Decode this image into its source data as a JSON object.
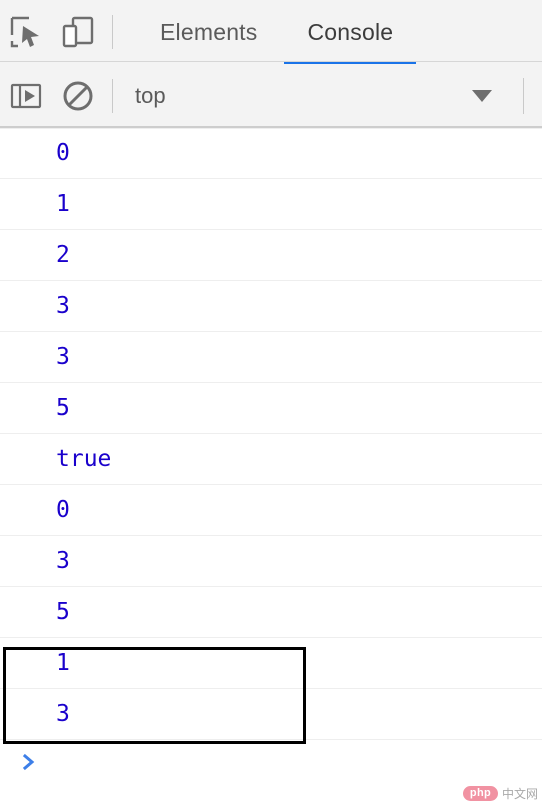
{
  "window": {
    "title": "DevTools Console"
  },
  "tabbar": {
    "icons": [
      {
        "name": "inspect-element-icon",
        "label": "Inspect element"
      },
      {
        "name": "device-toolbar-icon",
        "label": "Toggle device toolbar"
      }
    ],
    "tabs": [
      {
        "label": "Elements",
        "active": false
      },
      {
        "label": "Console",
        "active": true
      }
    ],
    "active_tab_underline_color": "#1a73e8"
  },
  "console_toolbar": {
    "icons": [
      {
        "name": "console-sidebar-icon",
        "label": "Show console sidebar"
      },
      {
        "name": "clear-console-icon",
        "label": "Clear console"
      }
    ],
    "context_selector": {
      "value": "top",
      "arrow": "chevron-down-icon"
    }
  },
  "console_log": {
    "entries": [
      {
        "value": "0",
        "type": "number"
      },
      {
        "value": "1",
        "type": "number"
      },
      {
        "value": "2",
        "type": "number"
      },
      {
        "value": "3",
        "type": "number"
      },
      {
        "value": "3",
        "type": "number"
      },
      {
        "value": "5",
        "type": "number"
      },
      {
        "value": "true",
        "type": "boolean"
      },
      {
        "value": "0",
        "type": "number"
      },
      {
        "value": "3",
        "type": "number"
      },
      {
        "value": "5",
        "type": "number"
      },
      {
        "value": "1",
        "type": "number"
      },
      {
        "value": "3",
        "type": "number"
      }
    ],
    "value_color": "#1a01cc",
    "row_separator_color": "#eeeeee"
  },
  "prompt": {
    "chevron": "chevron-right-icon",
    "value": "",
    "placeholder": "",
    "chevron_color": "#3d7fe8"
  },
  "annotation": {
    "shape": "rectangle",
    "color": "#000000",
    "highlights_entries": [
      "1",
      "3"
    ]
  },
  "watermark": {
    "badge": "php",
    "text": "中文网",
    "badge_color": "#ef7f92"
  }
}
